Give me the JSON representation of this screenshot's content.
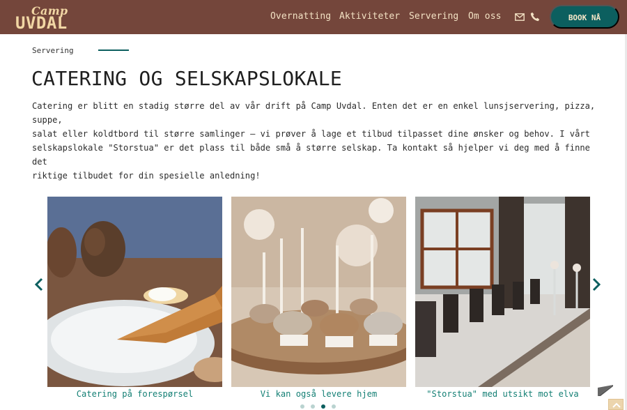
{
  "header": {
    "logo_top": "Camp",
    "logo_bottom": "UVDAL",
    "nav": [
      "Overnatting",
      "Aktiviteter",
      "Servering",
      "Om oss"
    ],
    "book_label": "BOOK NÅ",
    "icons": [
      "mail-icon",
      "phone-icon"
    ]
  },
  "breadcrumb": "Servering",
  "title": "CATERING OG SELSKAPSLOKALE",
  "intro": "Catering er blitt en stadig større del av vår drift på Camp Uvdal. Enten det er en enkel lunsjservering, pizza, suppe,\nsalat eller koldtbord til større samlinger – vi prøver å lage et tilbud tilpasset dine ønsker og behov. I vårt\nselskapslokale \"Storstua\" er det plass til både små å større selskap. Ta kontakt så hjelper vi deg med å finne det\nriktige tilbudet for din spesielle anledning!",
  "carousel": {
    "slides": [
      {
        "caption": "Catering på forespørsel"
      },
      {
        "caption": "Vi kan også levere hjem"
      },
      {
        "caption": "\"Storstua\" med utsikt mot elva"
      }
    ],
    "dots": 4,
    "active_dot": 2
  },
  "colors": {
    "header_bg": "#74463b",
    "brand_teal": "#0c5f5f",
    "caption_teal": "#137f74",
    "logo_cream": "#f1d6a4"
  }
}
